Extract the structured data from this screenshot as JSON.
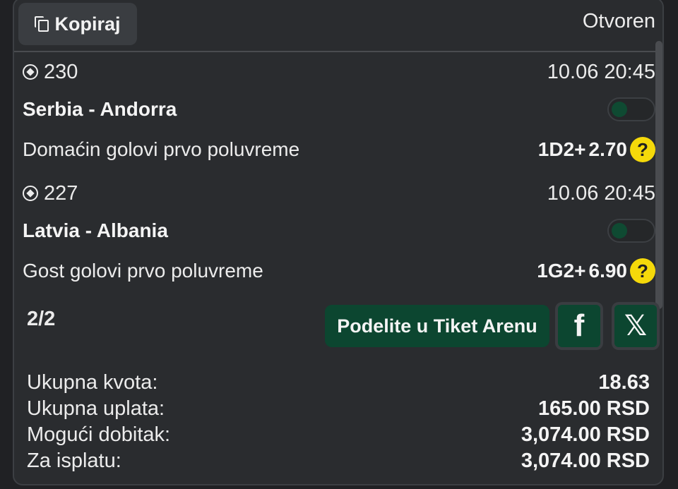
{
  "header": {
    "copy_label": "Kopiraj",
    "status": "Otvoren"
  },
  "matches": [
    {
      "code": "230",
      "datetime": "10.06 20:45",
      "teams": "Serbia - Andorra",
      "market": "Domaćin golovi prvo poluvreme",
      "pick": "1D2+",
      "odd": "2.70"
    },
    {
      "code": "227",
      "datetime": "10.06 20:45",
      "teams": "Latvia - Albania",
      "market": "Gost golovi prvo poluvreme",
      "pick": "1G2+",
      "odd": "6.90"
    }
  ],
  "footer": {
    "count": "2/2",
    "share_label": "Podelite u Tiket Arenu",
    "facebook_glyph": "f",
    "x_glyph": "𝕏"
  },
  "summary": [
    {
      "label": "Ukupna kvota:",
      "value": "18.63"
    },
    {
      "label": "Ukupna uplata:",
      "value": "165.00 RSD"
    },
    {
      "label": "Mogući dobitak:",
      "value": "3,074.00 RSD"
    },
    {
      "label": "Za isplatu:",
      "value": "3,074.00 RSD"
    }
  ],
  "icons": {
    "help": "?",
    "ball": "soccer-ball-icon",
    "copy": "copy-icon"
  },
  "colors": {
    "accent_green": "#0c4630",
    "help_yellow": "#f5d90a",
    "card_bg": "#2a2c2f"
  }
}
